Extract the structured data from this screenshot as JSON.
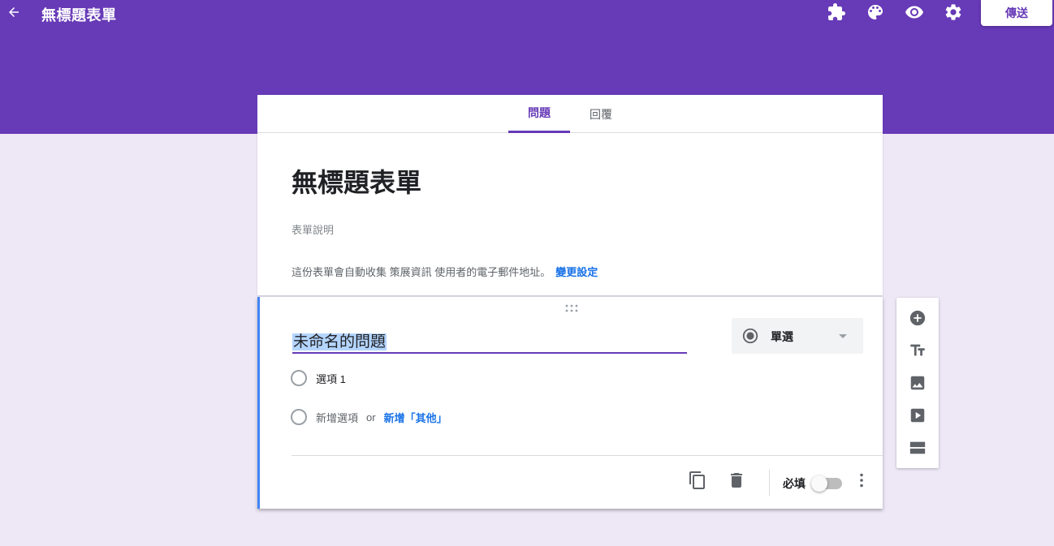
{
  "header": {
    "title": "無標題表單",
    "send_label": "傳送",
    "icons": [
      "back-arrow-icon",
      "addon-puzzle-icon",
      "palette-icon",
      "preview-eye-icon",
      "settings-gear-icon"
    ],
    "color": "#673ab7"
  },
  "tabs": [
    {
      "label": "問題",
      "active": true
    },
    {
      "label": "回覆",
      "active": false
    }
  ],
  "form": {
    "title": "無標題表單",
    "description_placeholder": "表單說明",
    "collect_note": "這份表單會自動收集 策展資訊 使用者的電子郵件地址。",
    "change_settings": "變更設定"
  },
  "question": {
    "title": "未命名的問題",
    "type": "單選",
    "options": [
      {
        "label": "選項 1"
      }
    ],
    "add_option": "新增選項",
    "or": "or",
    "add_other": "新增「其他」",
    "required_label": "必填",
    "required": false
  },
  "side_toolbar": {
    "icons": [
      "add-question-icon",
      "title-text-icon",
      "image-icon",
      "video-icon",
      "section-icon"
    ]
  }
}
